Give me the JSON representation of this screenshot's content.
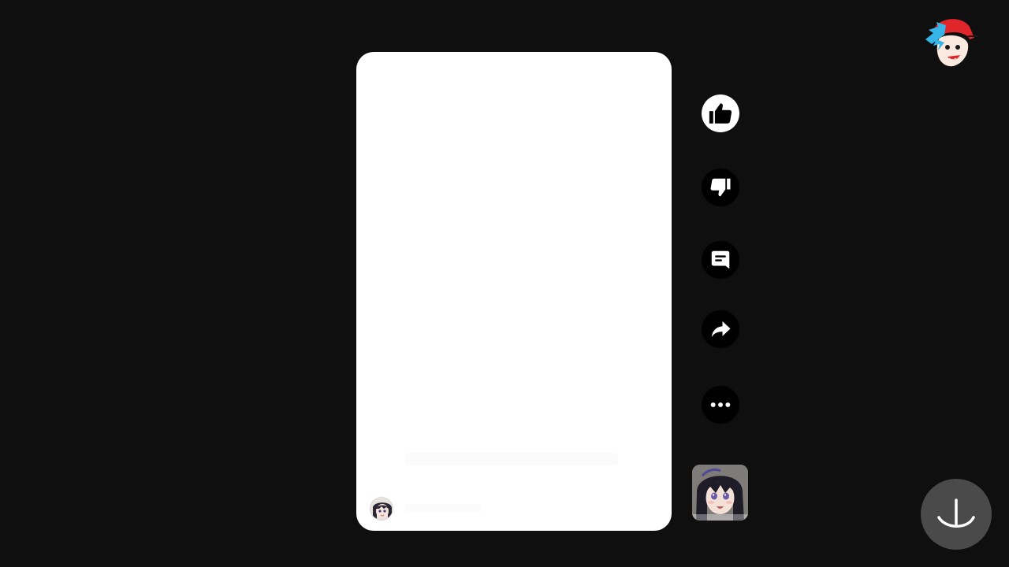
{
  "player": {
    "background_color": "#0f0f0f",
    "card_color": "#ffffff",
    "channel_avatar_icon": "anime-girl-avatar-icon"
  },
  "actions": [
    {
      "name": "like",
      "icon": "thumbs-up-icon",
      "fill": "#ffffff"
    },
    {
      "name": "dislike",
      "icon": "thumbs-down-icon",
      "fill": "#000000"
    },
    {
      "name": "comment",
      "icon": "comment-icon",
      "fill": "#000000"
    },
    {
      "name": "share",
      "icon": "share-arrow-icon",
      "fill": "#000000"
    },
    {
      "name": "more",
      "icon": "more-horizontal-icon",
      "fill": "#000000"
    }
  ],
  "sound": {
    "thumbnail_icon": "anime-girl-sound-thumbnail"
  },
  "header": {
    "profile_icon": "cartoon-character-profile-icon"
  },
  "fab": {
    "icon": "download-arrow-icon",
    "background": "#4a4a4a"
  }
}
